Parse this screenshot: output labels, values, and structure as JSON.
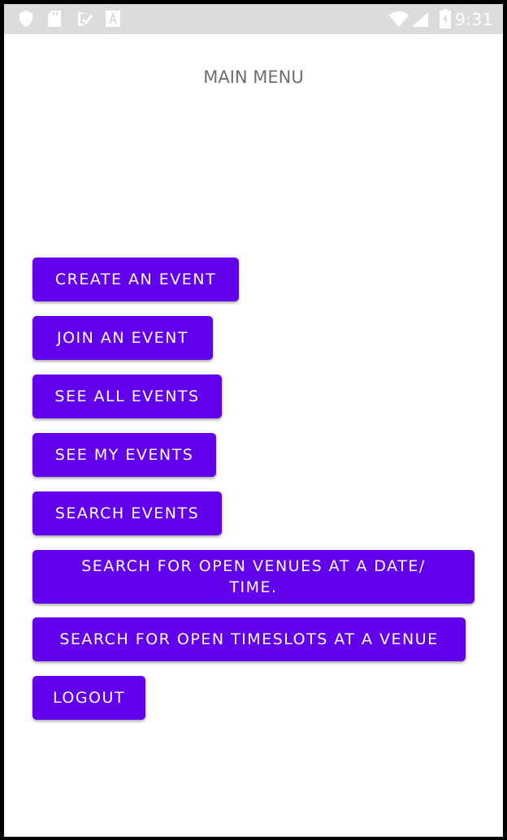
{
  "status_bar": {
    "time": "9:31",
    "left_icons": [
      "shield-icon",
      "sd-card-icon",
      "download-check-icon",
      "text-a-icon"
    ],
    "right_icons": [
      "wifi-icon",
      "cell-signal-icon",
      "battery-charging-icon"
    ],
    "background": "#dcdcdc"
  },
  "header": {
    "title": "MAIN MENU"
  },
  "menu": {
    "button_color": "#6200ee",
    "items": [
      {
        "label": "CREATE AN EVENT"
      },
      {
        "label": "JOIN AN EVENT"
      },
      {
        "label": "SEE ALL EVENTS"
      },
      {
        "label": "SEE MY EVENTS"
      },
      {
        "label": "SEARCH EVENTS"
      },
      {
        "label": "SEARCH FOR OPEN VENUES AT A DATE/ TIME."
      },
      {
        "label": "SEARCH FOR OPEN TIMESLOTS AT A VENUE"
      },
      {
        "label": "LOGOUT"
      }
    ]
  }
}
